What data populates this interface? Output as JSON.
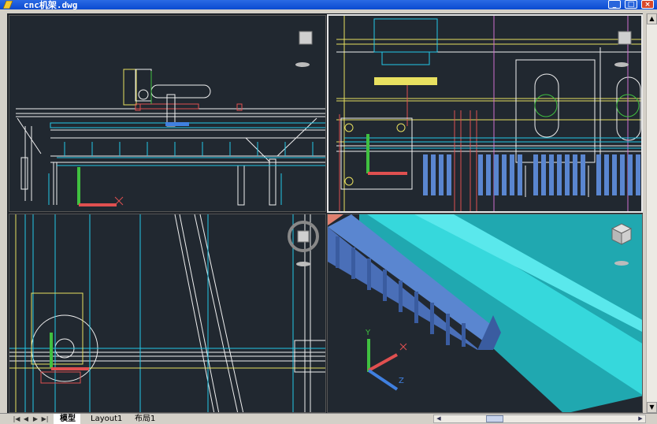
{
  "window": {
    "title": "cnc机架.dwg",
    "minimize_label": "_",
    "maximize_label": "□",
    "close_label": "×"
  },
  "colors": {
    "background": "#212830",
    "active_border": "#e8e8e8",
    "cyan": "#22c8e8",
    "yellow": "#e8e060",
    "green": "#40c040",
    "white": "#f0f0f0",
    "red": "#e05050",
    "blue": "#4080e0",
    "rack_blue": "#5a86d0",
    "rail_cyan": "#22c8c8"
  },
  "viewports": [
    {
      "name": "front-view",
      "view_icon": "top-view-cube-icon",
      "active": false
    },
    {
      "name": "top-view",
      "view_icon": "top-view-cube-icon",
      "active": true
    },
    {
      "name": "side-view",
      "view_icon": "view-compass-icon",
      "active": false
    },
    {
      "name": "iso-view",
      "view_icon": "iso-view-cube-icon",
      "active": false
    }
  ],
  "ucs": {
    "x_label": "X",
    "y_label": "Y",
    "z_label": "Z"
  },
  "layout_tabs": {
    "model": "模型",
    "layout1": "Layout1",
    "layout2": "布局1",
    "separator": "/"
  },
  "nav_buttons": [
    "|◀",
    "◀",
    "▶",
    "▶|"
  ],
  "scroll": {
    "up": "▲",
    "down": "▼",
    "left": "◀",
    "right": "▶"
  }
}
